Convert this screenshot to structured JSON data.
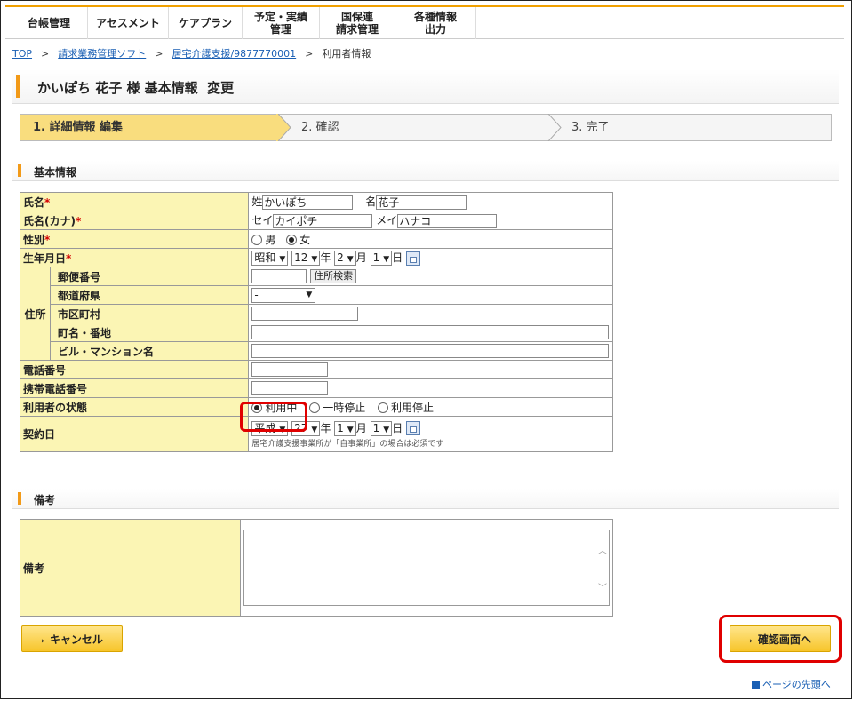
{
  "nav": [
    "台帳管理",
    "アセスメント",
    "ケアプラン",
    "予定・実績\n管理",
    "国保連\n請求管理",
    "各種情報\n出力"
  ],
  "breadcrumb": {
    "top": "TOP",
    "billing": "請求業務管理ソフト",
    "office": "居宅介護支援/9877770001",
    "current": "利用者情報"
  },
  "page_title": "かいぽち 花子 様 基本情報  変更",
  "steps": [
    "1. 詳細情報 編集",
    "2. 確認",
    "3. 完了"
  ],
  "section_basic": "基本情報",
  "section_remarks": "備考",
  "fields": {
    "name_label": "氏名",
    "name_sei_prefix": "姓",
    "name_sei": "かいぽち",
    "name_mei_prefix": "名",
    "name_mei": "花子",
    "kana_label": "氏名(カナ)",
    "kana_sei_prefix": "セイ",
    "kana_sei": "カイポチ",
    "kana_mei_prefix": "メイ",
    "kana_mei": "ハナコ",
    "gender_label": "性別",
    "gender_male": "男",
    "gender_female": "女",
    "birth_label": "生年月日",
    "birth_era": "昭和",
    "birth_year": "12",
    "birth_month": "2",
    "birth_day": "1",
    "unit_year": "年",
    "unit_month": "月",
    "unit_day": "日",
    "address_group": "住所",
    "postal_label": "郵便番号",
    "postal_button": "住所検索",
    "prefecture_label": "都道府県",
    "prefecture_value": "-",
    "city_label": "市区町村",
    "street_label": "町名・番地",
    "building_label": "ビル・マンション名",
    "phone_label": "電話番号",
    "mobile_label": "携帯電話番号",
    "status_label": "利用者の状態",
    "status_active": "利用中",
    "status_paused": "一時停止",
    "status_stopped": "利用停止",
    "contract_label": "契約日",
    "contract_era": "平成",
    "contract_year": "27",
    "contract_month": "1",
    "contract_day": "1",
    "contract_hint": "居宅介護支援事業所が「自事業所」の場合は必須です",
    "required_mark": "*"
  },
  "remarks_label": "備考",
  "buttons": {
    "cancel": "キャンセル",
    "confirm": "確認画面へ",
    "page_top": "ページの先頭へ"
  },
  "colors": {
    "accent": "#f29a18",
    "label_bg": "#fbf5b4",
    "highlight": "#e00000",
    "button": "#f7c52a"
  }
}
